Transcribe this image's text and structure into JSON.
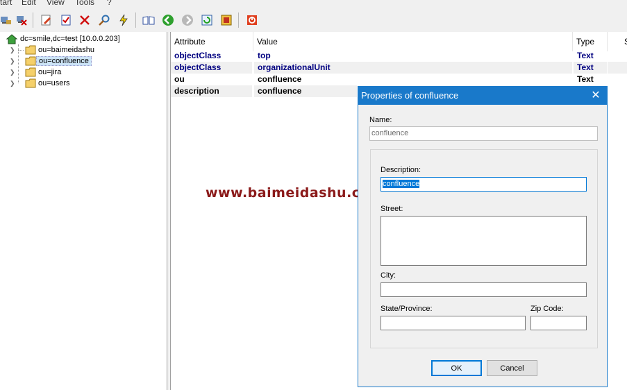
{
  "menu": {
    "start": "tart",
    "edit": "Edit",
    "view": "View",
    "tools": "Tools",
    "help": "?"
  },
  "toolbar": {
    "icons": [
      "connect-icon",
      "disconnect-icon",
      "edit-icon",
      "properties-icon",
      "delete-icon",
      "search-icon",
      "flash-icon",
      "book-icon",
      "back-icon",
      "forward-icon",
      "refresh-icon",
      "schema-icon",
      "stop-icon"
    ]
  },
  "tree": {
    "root": "dc=smile,dc=test [10.0.0.203]",
    "children": [
      {
        "label": "ou=baimeidashu"
      },
      {
        "label": "ou=confluence",
        "selected": true
      },
      {
        "label": "ou=jira"
      },
      {
        "label": "ou=users"
      }
    ]
  },
  "grid": {
    "headers": {
      "attribute": "Attribute",
      "value": "Value",
      "type": "Type",
      "size": "S"
    },
    "rows": [
      {
        "attribute": "objectClass",
        "value": "top",
        "type": "Text",
        "color": "#000080"
      },
      {
        "attribute": "objectClass",
        "value": "organizationalUnit",
        "type": "Text",
        "color": "#000080"
      },
      {
        "attribute": "ou",
        "value": "confluence",
        "type": "Text",
        "color": "#000000"
      },
      {
        "attribute": "description",
        "value": "confluence",
        "type": "Text",
        "color": "#000000"
      }
    ]
  },
  "watermark": "www.baimeidashu.com-白眉大叔",
  "dialog": {
    "title": "Properties of confluence",
    "name_label": "Name:",
    "name_value": "confluence",
    "description_label": "Description:",
    "description_value": "confluence",
    "street_label": "Street:",
    "street_value": "",
    "city_label": "City:",
    "city_value": "",
    "state_label": "State/Province:",
    "state_value": "",
    "zip_label": "Zip Code:",
    "zip_value": "",
    "ok_label": "OK",
    "cancel_label": "Cancel",
    "close_glyph": "✕"
  },
  "colors": {
    "accent": "#1979ca",
    "selection": "#0078d7",
    "attr_navy": "#000080",
    "watermark": "#8b1a1a"
  }
}
